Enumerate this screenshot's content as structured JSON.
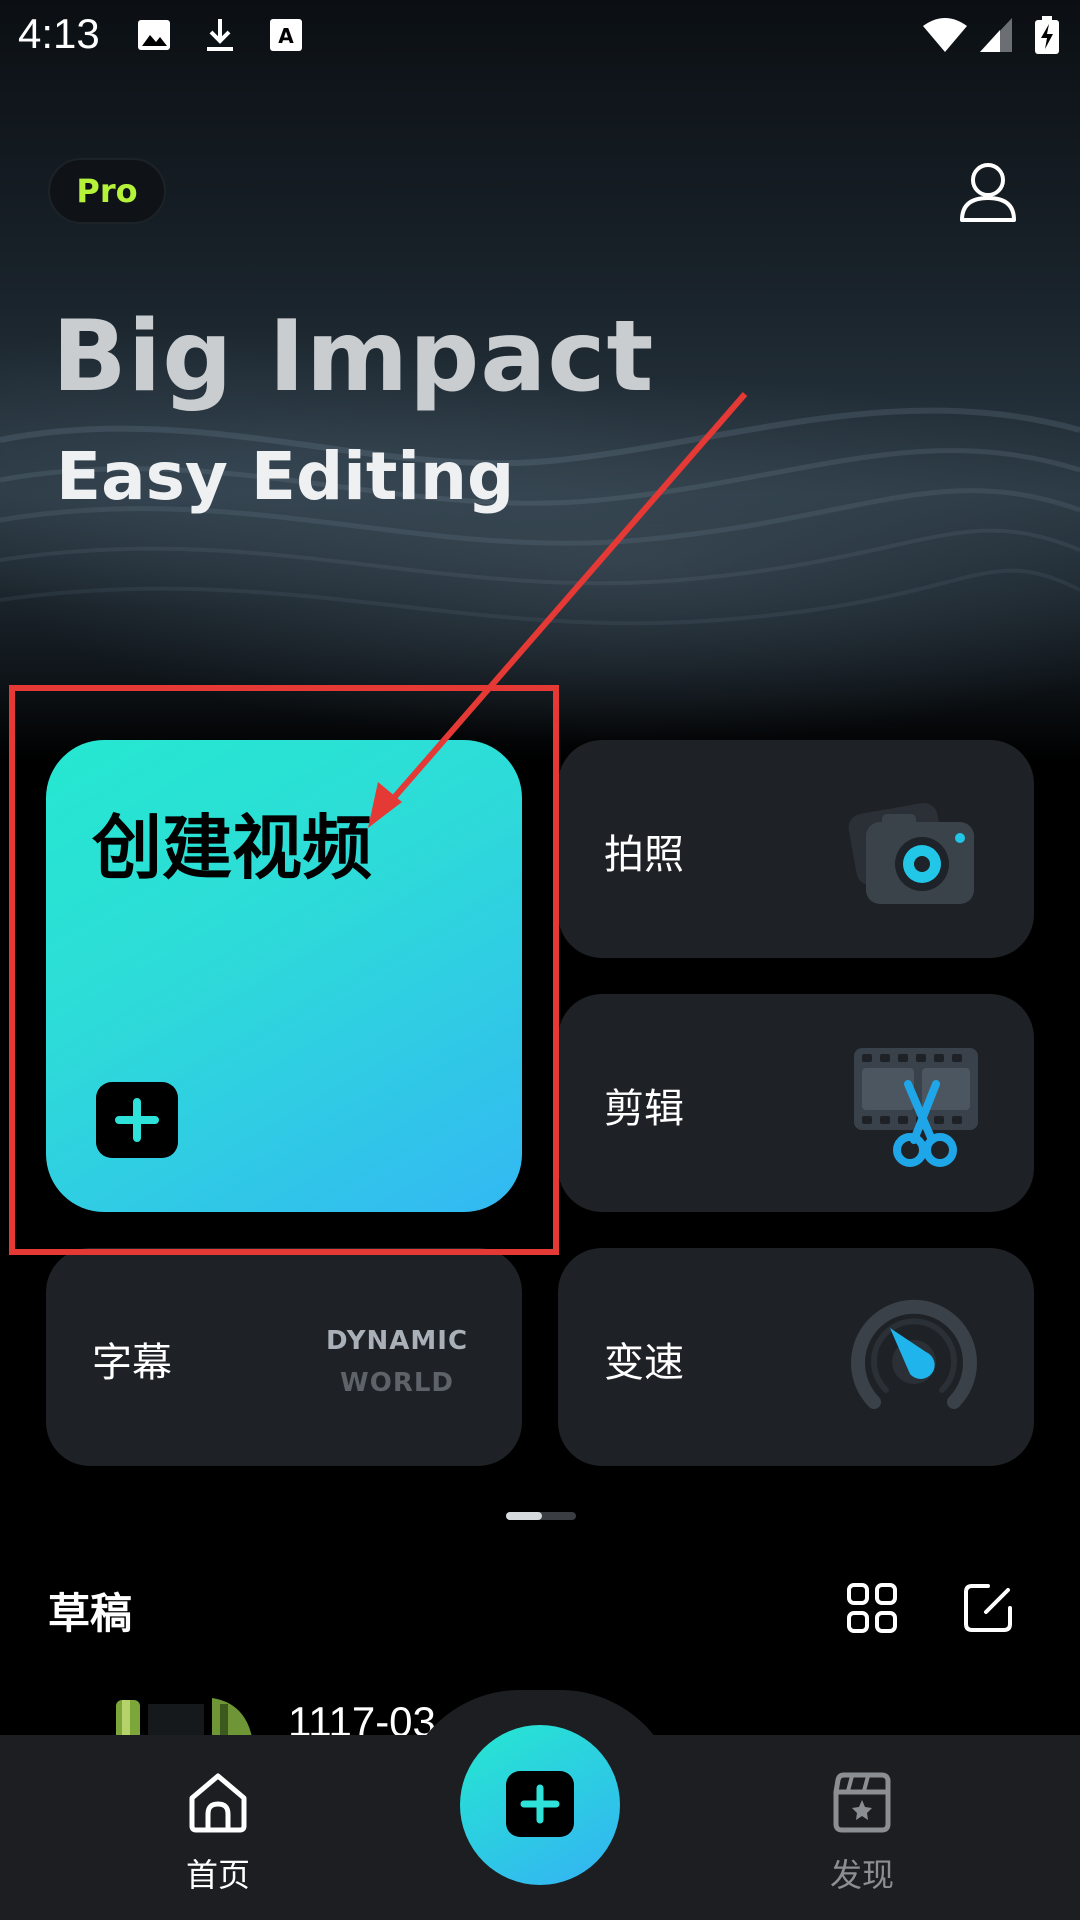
{
  "status_bar": {
    "time": "4:13",
    "icons": [
      "image-icon",
      "download-icon",
      "font-icon",
      "wifi-icon",
      "signal-icon",
      "battery-charging-icon"
    ]
  },
  "header": {
    "pro_badge": "Pro",
    "profile_icon": "user-icon"
  },
  "hero": {
    "headline": "Big Impact",
    "subheadline": "Easy Editing"
  },
  "cards": {
    "create_video": {
      "label": "创建视频",
      "icon": "plus-icon"
    },
    "photo": {
      "label": "拍照",
      "icon": "camera-icon"
    },
    "edit": {
      "label": "剪辑",
      "icon": "film-scissors-icon"
    },
    "subtitles": {
      "label": "字幕",
      "art_line1": "DYNAMIC",
      "art_line2": "WORLD"
    },
    "speed": {
      "label": "变速",
      "icon": "speedometer-icon"
    }
  },
  "drafts": {
    "title": "草稿",
    "items": [
      {
        "name": "1117-03"
      }
    ]
  },
  "bottom_nav": {
    "home": {
      "label": "首页",
      "icon": "home-icon"
    },
    "create": {
      "icon": "plus-icon"
    },
    "discover": {
      "label": "发现",
      "icon": "clapperboard-star-icon"
    }
  },
  "colors": {
    "accent_start": "#25e8d0",
    "accent_end": "#34b2f4",
    "pro_text": "#b5f23a",
    "annotation_red": "#e53935",
    "card_bg": "#1e2125"
  }
}
